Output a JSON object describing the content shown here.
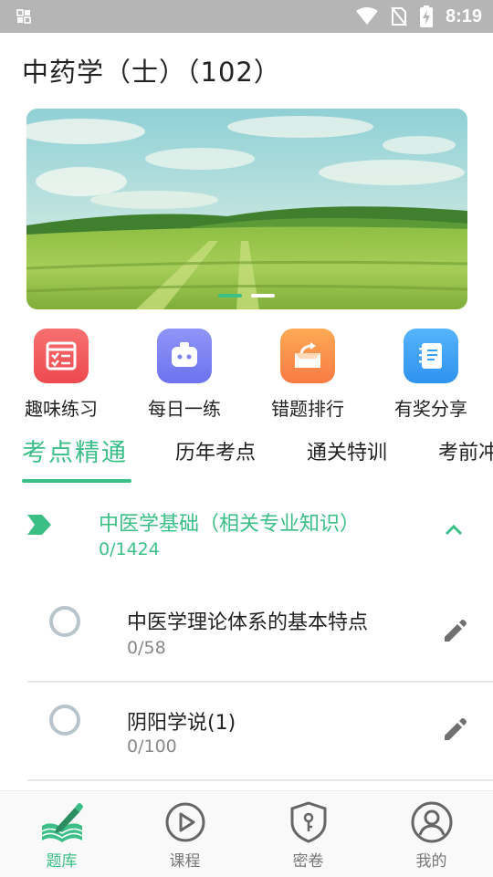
{
  "status_bar": {
    "time": "8:19",
    "icons": [
      "notification-icon",
      "wifi-icon",
      "no-sim-icon",
      "battery-charging-icon"
    ]
  },
  "page": {
    "title": "中药学（士）（102）"
  },
  "banner": {
    "image": "green-wheat-field-under-blue-sky",
    "dots_total": 2,
    "active_dot": 1
  },
  "quick_actions": [
    {
      "label": "趣味练习",
      "icon": "practice-checklist-icon",
      "color": "#f25a5c"
    },
    {
      "label": "每日一练",
      "icon": "robot-icon",
      "color": "#7c83f3"
    },
    {
      "label": "错题排行",
      "icon": "share-folder-icon",
      "color": "#fb8f4d"
    },
    {
      "label": "有奖分享",
      "icon": "notebook-icon",
      "color": "#3ba0f5"
    }
  ],
  "tabs": [
    {
      "label": "考点精通",
      "active": true
    },
    {
      "label": "历年考点",
      "active": false
    },
    {
      "label": "通关特训",
      "active": false
    },
    {
      "label": "考前冲刺",
      "active": false
    }
  ],
  "chapter": {
    "title": "中医学基础（相关专业知识）",
    "count": "0/1424",
    "expanded": true
  },
  "items": [
    {
      "name": "中医学理论体系的基本特点",
      "count": "0/58"
    },
    {
      "name": "阴阳学说(1)",
      "count": "0/100"
    }
  ],
  "bottom_nav": [
    {
      "label": "题库",
      "icon": "book-pen-icon",
      "active": true
    },
    {
      "label": "课程",
      "icon": "play-circle-icon",
      "active": false
    },
    {
      "label": "密卷",
      "icon": "shield-key-icon",
      "active": false
    },
    {
      "label": "我的",
      "icon": "user-circle-icon",
      "active": false
    }
  ],
  "colors": {
    "accent": "#3bbf87",
    "status_bar": "#b5b5b5",
    "secondary_text": "#888888"
  }
}
